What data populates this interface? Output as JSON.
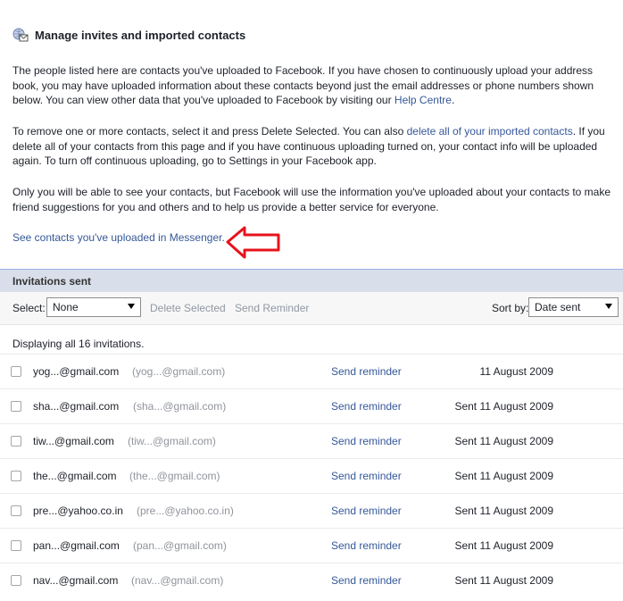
{
  "header": {
    "title": "Manage invites and imported contacts",
    "icon": "contacts-icon"
  },
  "intro": {
    "p1_text": "The people listed here are contacts you've uploaded to Facebook. If you have chosen to continuously upload your address book, you may have uploaded information about these contacts beyond just the email addresses or phone numbers shown below. You can view other data that you've uploaded to Facebook by visiting our ",
    "p1_link": "Help Centre",
    "p1_end": ".",
    "p2_start": "To remove one or more contacts, select it and press Delete Selected. You can also ",
    "p2_link": "delete all of your imported contacts",
    "p2_end": ". If you delete all of your contacts from this page and if you have continuous uploading turned on, your contact info will be uploaded again. To turn off continuous uploading, go to Settings in your Facebook app.",
    "p3_text": "Only you will be able to see your contacts, but Facebook will use the information you've uploaded about your contacts to make friend suggestions for you and others and to help us provide a better service for everyone.",
    "messenger_link": "See contacts you've uploaded in Messenger."
  },
  "section": {
    "title": "Invitations sent"
  },
  "toolbar": {
    "select_label": "Select:",
    "select_value": "None",
    "delete_label": "Delete Selected",
    "reminder_label": "Send Reminder",
    "sort_label": "Sort by:",
    "sort_value": "Date sent"
  },
  "displaying": "Displaying all 16 invitations.",
  "invitations": [
    {
      "email": "yog...@gmail.com",
      "sub": "(yog...@gmail.com)",
      "action": "Send reminder",
      "date": "11 August 2009"
    },
    {
      "email": "sha...@gmail.com",
      "sub": "(sha...@gmail.com)",
      "action": "Send reminder",
      "date": "Sent 11 August 2009"
    },
    {
      "email": "tiw...@gmail.com",
      "sub": "(tiw...@gmail.com)",
      "action": "Send reminder",
      "date": "Sent 11 August 2009"
    },
    {
      "email": "the...@gmail.com",
      "sub": "(the...@gmail.com)",
      "action": "Send reminder",
      "date": "Sent 11 August 2009"
    },
    {
      "email": "pre...@yahoo.co.in",
      "sub": "(pre...@yahoo.co.in)",
      "action": "Send reminder",
      "date": "Sent 11 August 2009"
    },
    {
      "email": "pan...@gmail.com",
      "sub": "(pan...@gmail.com)",
      "action": "Send reminder",
      "date": "Sent 11 August 2009"
    },
    {
      "email": "nav...@gmail.com",
      "sub": "(nav...@gmail.com)",
      "action": "Send reminder",
      "date": "Sent 11 August 2009"
    }
  ],
  "colors": {
    "link": "#365899",
    "section_bg": "#d8dfea",
    "arrow": "#e8131b"
  }
}
